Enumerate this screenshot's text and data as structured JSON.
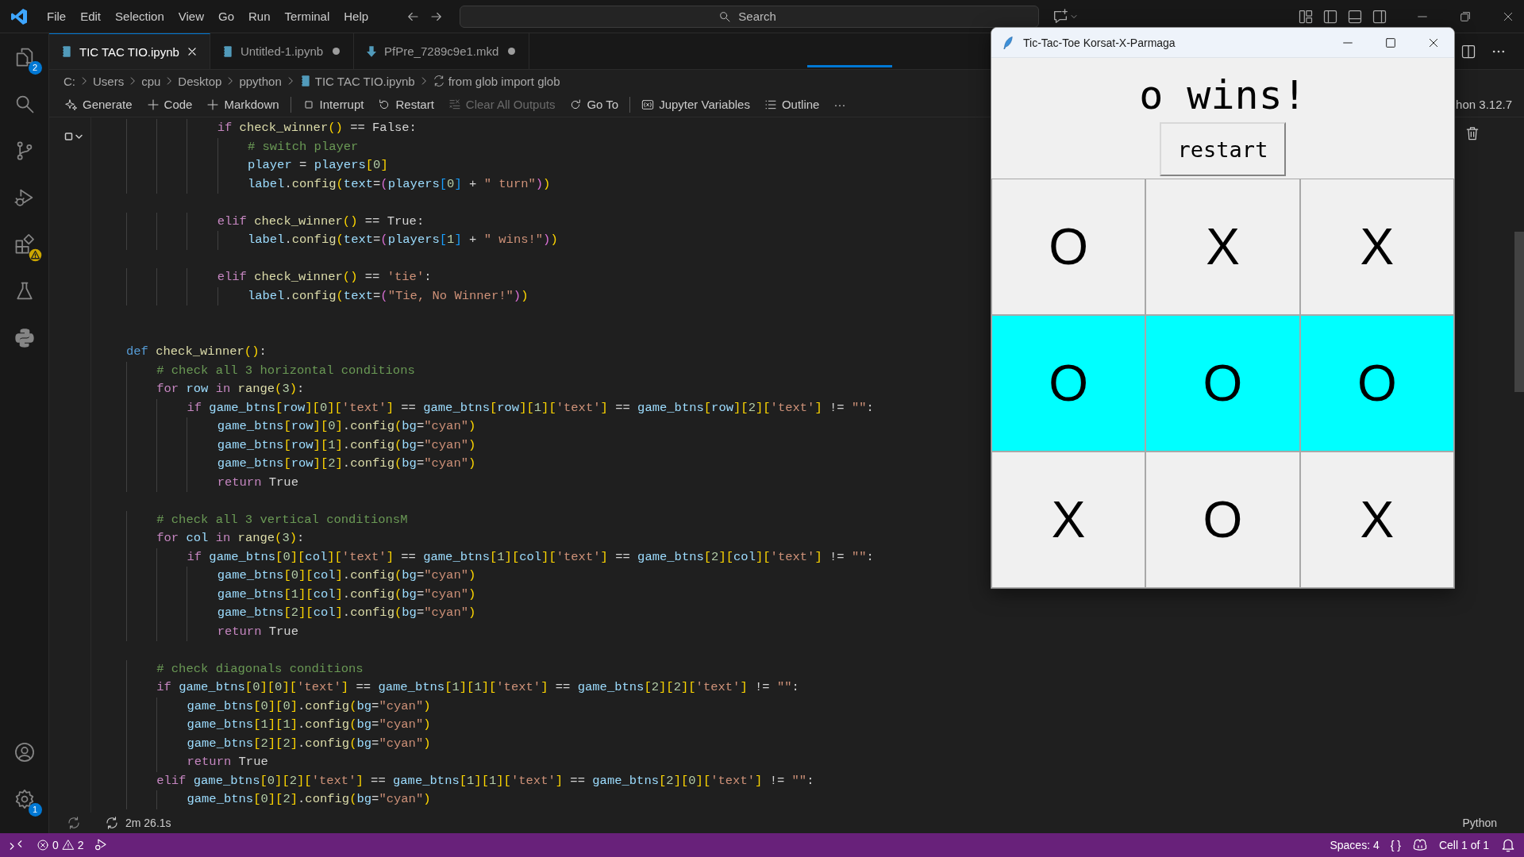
{
  "title_bar": {
    "menu": [
      "File",
      "Edit",
      "Selection",
      "View",
      "Go",
      "Run",
      "Terminal",
      "Help"
    ],
    "search": {
      "placeholder": "Search"
    }
  },
  "activity_bar": {
    "top": [
      {
        "kind": "files",
        "badge": "2",
        "selected": false
      },
      {
        "kind": "search",
        "selected": false
      },
      {
        "kind": "branch",
        "selected": false
      },
      {
        "kind": "run",
        "selected": false
      },
      {
        "kind": "extensions",
        "warning": true,
        "selected": false
      },
      {
        "kind": "flask",
        "selected": false
      },
      {
        "kind": "python",
        "selected": false
      }
    ],
    "bottom": [
      {
        "kind": "account"
      },
      {
        "kind": "settings",
        "badge": "1"
      }
    ]
  },
  "tabs": [
    {
      "label": "TIC TAC TIO.ipynb",
      "kind": "notebook",
      "selected": true,
      "modified": false
    },
    {
      "label": "Untitled-1.ipynb",
      "kind": "notebook",
      "selected": false,
      "modified": true
    },
    {
      "label": "PfPre_7289c9e1.mkd",
      "kind": "markdown",
      "selected": false,
      "modified": true
    }
  ],
  "breadcrumbs": [
    {
      "label": "C:"
    },
    {
      "label": "Users"
    },
    {
      "label": "cpu"
    },
    {
      "label": "Desktop"
    },
    {
      "label": "ppython"
    },
    {
      "label": "TIC TAC TIO.ipynb",
      "kind": "notebook"
    },
    {
      "label": "from glob import glob",
      "kind": "cell"
    }
  ],
  "toolbar": {
    "items": [
      {
        "label": "Generate",
        "kind": "sparkle",
        "disabled": false
      },
      {
        "label": "Code",
        "kind": "plus",
        "disabled": false
      },
      {
        "label": "Markdown",
        "kind": "plus",
        "disabled": false
      },
      {
        "kind": "separator"
      },
      {
        "label": "Interrupt",
        "kind": "stop",
        "disabled": false
      },
      {
        "label": "Restart",
        "kind": "restart",
        "disabled": false
      },
      {
        "label": "Clear All Outputs",
        "kind": "clear",
        "disabled": true
      },
      {
        "label": "Go To",
        "kind": "goto",
        "disabled": false
      },
      {
        "kind": "separator"
      },
      {
        "label": "Jupyter Variables",
        "kind": "variables",
        "disabled": false
      },
      {
        "label": "Outline",
        "kind": "outline",
        "disabled": false
      },
      {
        "label": "···",
        "kind": "more",
        "disabled": false
      }
    ],
    "kernel": "hon 3.12.7"
  },
  "cell": {
    "lines": [
      {
        "kind": "code",
        "parts": [
          {
            "kind": "keyword",
            "text": "            if"
          },
          {
            "kind": "code",
            "text": " check_winner() == "
          },
          {
            "kind": "plain",
            "text": "False"
          },
          {
            "kind": "code",
            "text": ":"
          }
        ]
      },
      {
        "kind": "code",
        "parts": [
          {
            "kind": "code",
            "text": "                # switch player"
          }
        ]
      },
      {
        "kind": "code",
        "parts": [
          {
            "kind": "code",
            "text": "                player = players[0]"
          }
        ]
      },
      {
        "kind": "code",
        "parts": [
          {
            "kind": "code",
            "text": "                label.config(text=(players[0] + \" turn\"))"
          }
        ]
      },
      {
        "kind": "blank"
      },
      {
        "kind": "code",
        "parts": [
          {
            "kind": "keyword",
            "text": "            elif"
          },
          {
            "kind": "code",
            "text": " check_winner() == "
          },
          {
            "kind": "plain",
            "text": "True"
          },
          {
            "kind": "code",
            "text": ":"
          }
        ]
      },
      {
        "kind": "code",
        "parts": [
          {
            "kind": "code",
            "text": "                label.config(text=(players[1] + \" wins!\"))"
          }
        ]
      },
      {
        "kind": "blank"
      },
      {
        "kind": "code",
        "parts": [
          {
            "kind": "keyword",
            "text": "            elif"
          },
          {
            "kind": "code",
            "text": " check_winner() == 'tie':"
          }
        ]
      },
      {
        "kind": "code",
        "parts": [
          {
            "kind": "code",
            "text": "                label.config(text=(\"Tie, No Winner!\"))"
          }
        ]
      },
      {
        "kind": "blank"
      },
      {
        "kind": "blank"
      },
      {
        "kind": "code",
        "parts": [
          {
            "kind": "def",
            "text": "def"
          },
          {
            "kind": "code",
            "text": " check_winner():"
          }
        ]
      },
      {
        "kind": "code",
        "parts": [
          {
            "kind": "code",
            "text": "    # check all 3 horizontal conditions"
          }
        ]
      },
      {
        "kind": "code",
        "parts": [
          {
            "kind": "keyword",
            "text": "    for"
          },
          {
            "kind": "code",
            "text": " row "
          },
          {
            "kind": "keyword",
            "text": "in"
          },
          {
            "kind": "code",
            "text": " range(3):"
          }
        ]
      },
      {
        "kind": "code",
        "parts": [
          {
            "kind": "keyword",
            "text": "        if"
          },
          {
            "kind": "code",
            "text": " game_btns[row][0]['text'] == game_btns[row][1]['text'] == game_btns[row][2]['text'] != \"\":"
          }
        ]
      },
      {
        "kind": "code",
        "parts": [
          {
            "kind": "code",
            "text": "            game_btns[row][0].config(bg=\"cyan\")"
          }
        ]
      },
      {
        "kind": "code",
        "parts": [
          {
            "kind": "code",
            "text": "            game_btns[row][1].config(bg=\"cyan\")"
          }
        ]
      },
      {
        "kind": "code",
        "parts": [
          {
            "kind": "code",
            "text": "            game_btns[row][2].config(bg=\"cyan\")"
          }
        ]
      },
      {
        "kind": "code",
        "parts": [
          {
            "kind": "keyword",
            "text": "            return"
          },
          {
            "kind": "plain",
            "text": " True"
          }
        ]
      },
      {
        "kind": "blank"
      },
      {
        "kind": "code",
        "parts": [
          {
            "kind": "code",
            "text": "    # check all 3 vertical conditionsM"
          }
        ]
      },
      {
        "kind": "code",
        "parts": [
          {
            "kind": "keyword",
            "text": "    for"
          },
          {
            "kind": "code",
            "text": " col "
          },
          {
            "kind": "keyword",
            "text": "in"
          },
          {
            "kind": "code",
            "text": " range(3):"
          }
        ]
      },
      {
        "kind": "code",
        "parts": [
          {
            "kind": "keyword",
            "text": "        if"
          },
          {
            "kind": "code",
            "text": " game_btns[0][col]['text'] == game_btns[1][col]['text'] == game_btns[2][col]['text'] != \"\":"
          }
        ]
      },
      {
        "kind": "code",
        "parts": [
          {
            "kind": "code",
            "text": "            game_btns[0][col].config(bg=\"cyan\")"
          }
        ]
      },
      {
        "kind": "code",
        "parts": [
          {
            "kind": "code",
            "text": "            game_btns[1][col].config(bg=\"cyan\")"
          }
        ]
      },
      {
        "kind": "code",
        "parts": [
          {
            "kind": "code",
            "text": "            game_btns[2][col].config(bg=\"cyan\")"
          }
        ]
      },
      {
        "kind": "code",
        "parts": [
          {
            "kind": "keyword",
            "text": "            return"
          },
          {
            "kind": "plain",
            "text": " True"
          }
        ]
      },
      {
        "kind": "blank"
      },
      {
        "kind": "code",
        "parts": [
          {
            "kind": "code",
            "text": "    # check diagonals conditions"
          }
        ]
      },
      {
        "kind": "code",
        "parts": [
          {
            "kind": "keyword",
            "text": "    if"
          },
          {
            "kind": "code",
            "text": " game_btns[0][0]['text'] == game_btns[1][1]['text'] == game_btns[2][2]['text'] != \"\":"
          }
        ]
      },
      {
        "kind": "code",
        "parts": [
          {
            "kind": "code",
            "text": "        game_btns[0][0].config(bg=\"cyan\")"
          }
        ]
      },
      {
        "kind": "code",
        "parts": [
          {
            "kind": "code",
            "text": "        game_btns[1][1].config(bg=\"cyan\")"
          }
        ]
      },
      {
        "kind": "code",
        "parts": [
          {
            "kind": "code",
            "text": "        game_btns[2][2].config(bg=\"cyan\")"
          }
        ]
      },
      {
        "kind": "code",
        "parts": [
          {
            "kind": "keyword",
            "text": "        return"
          },
          {
            "kind": "plain",
            "text": " True"
          }
        ]
      },
      {
        "kind": "code",
        "parts": [
          {
            "kind": "keyword",
            "text": "    elif"
          },
          {
            "kind": "code",
            "text": " game_btns[0][2]['text'] == game_btns[1][1]['text'] == game_btns[2][0]['text'] != \"\":"
          }
        ]
      },
      {
        "kind": "code",
        "parts": [
          {
            "kind": "code",
            "text": "        game_btns[0][2].config(bg=\"cyan\")"
          }
        ]
      }
    ],
    "duration": "2m 26.1s",
    "language": "Python"
  },
  "status_bar": {
    "errors": "0",
    "warnings": "2",
    "right": [
      {
        "kind": "text",
        "label": "Spaces: 4"
      },
      {
        "kind": "text",
        "label": "{ }"
      },
      {
        "kind": "copilot"
      },
      {
        "kind": "text",
        "label": "Cell 1 of 1"
      },
      {
        "kind": "bell"
      }
    ]
  },
  "game_window": {
    "title": "Tic-Tac-Toe Korsat-X-Parmaga",
    "label": "o wins!",
    "button": "restart",
    "board": [
      [
        {
          "mark": "O",
          "highlighted": false
        },
        {
          "mark": "X",
          "highlighted": false
        },
        {
          "mark": "X",
          "highlighted": false
        }
      ],
      [
        {
          "mark": "O",
          "highlighted": true
        },
        {
          "mark": "O",
          "highlighted": true
        },
        {
          "mark": "O",
          "highlighted": true
        }
      ],
      [
        {
          "mark": "X",
          "highlighted": false
        },
        {
          "mark": "O",
          "highlighted": false
        },
        {
          "mark": "X",
          "highlighted": false
        }
      ]
    ]
  }
}
